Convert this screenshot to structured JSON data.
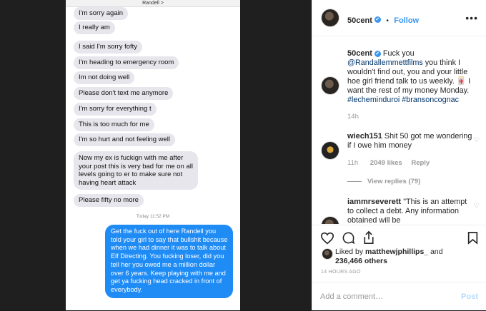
{
  "thread": {
    "contact": "Randell >",
    "received": [
      "I'm sorry again",
      "I really am",
      "I said I'm sorry fofty",
      "I'm heading to emergency room",
      "Im not doing well",
      "Please don't text me anymore",
      "I'm sorry for everything t",
      "This is too much for me",
      "I'm so hurt and not feeling well",
      "Now my ex is fuckign with me after your post this is very bad for me on all levels going to er to make sure not having heart attack",
      "Please fifty no more"
    ],
    "timestamp": "Today 11:52 PM",
    "sent": "Get the fuck out of here Randell you told your girl to say that bullshit because when we had dinner it was to talk about Elf Directing. You fucking loser, did you tell her you owed me a million dollar over 6 years. Keep playing with me and get ya fucking head cracked in front of everybody."
  },
  "header": {
    "username": "50cent",
    "verified_mark": "✔",
    "separator": "•",
    "follow_label": "Follow",
    "more_icon": "more-options-icon"
  },
  "caption": {
    "username": "50cent",
    "verified_mark": "✔",
    "part1": "Fuck you",
    "mention": "@Randallemmettfilms",
    "part2": "you think I wouldn't find out, you and your little hoe girl friend talk to us weekly. 🀄 I want the rest of my money Monday.",
    "hashtags": "#lecheminduroi #bransoncognac",
    "time": "14h"
  },
  "comments": [
    {
      "username": "wiech151",
      "text": "Shit 50 got me wondering if I owe him money",
      "time": "11h",
      "likes": "2049 likes",
      "reply": "Reply",
      "view_replies": "View replies (79)"
    },
    {
      "username": "iammrseverett",
      "text": "\"This is an attempt to collect a debt. Any information obtained will be"
    }
  ],
  "likes": {
    "prefix": "Liked by",
    "user": "matthewjphillips_",
    "suffix": "and",
    "count": "236,466 others"
  },
  "posted": "14 HOURS AGO",
  "add_comment": {
    "placeholder": "Add a comment…",
    "post_label": "Post"
  },
  "colors": {
    "accent": "#3897f0",
    "imessage_blue": "#1f8bf5",
    "bubble_gray": "#e6e6ec"
  }
}
